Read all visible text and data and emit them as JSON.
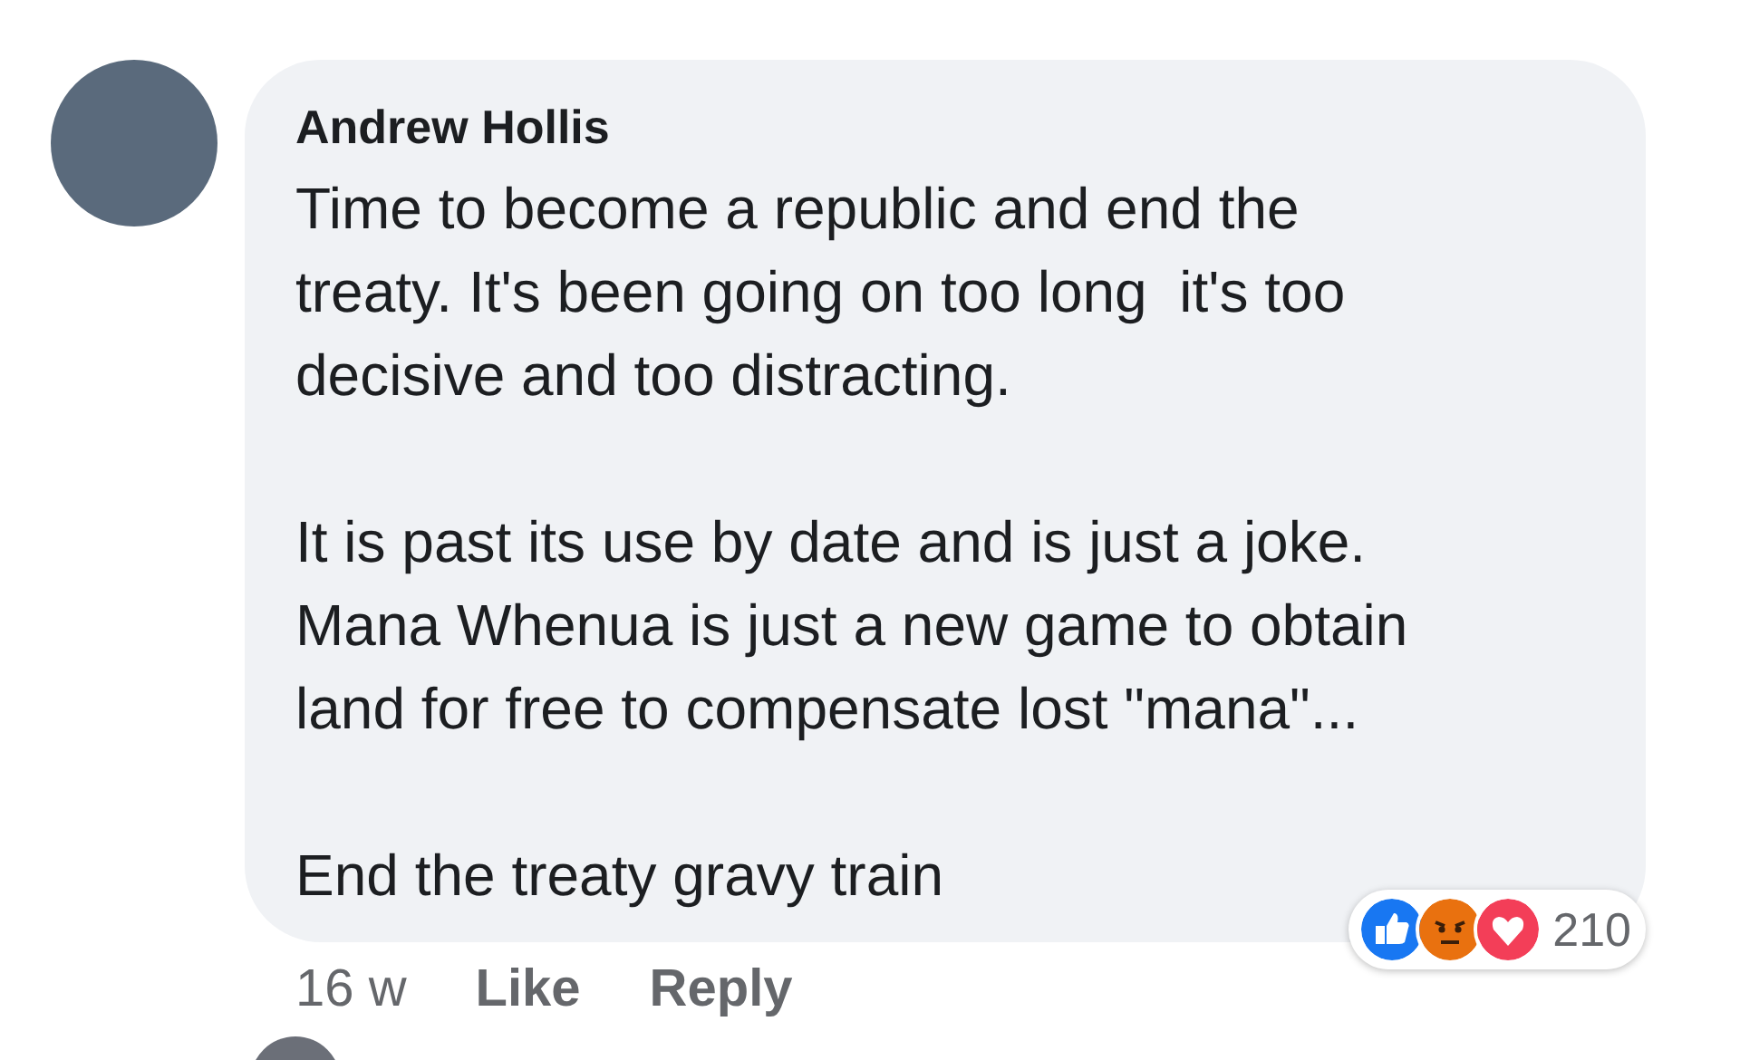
{
  "comment": {
    "author": "Andrew Hollis",
    "paragraphs": [
      "Time to become a republic and end the\ntreaty. It's been going on too long  it's too\ndecisive and too distracting.",
      "It is past its use by date and is just a joke.\nMana Whenua is just a new game to obtain\nland for free to compensate lost \"mana\"...",
      "End the treaty gravy train"
    ],
    "time": "16 w",
    "actions": [
      "Like",
      "Reply"
    ],
    "reactions": {
      "icons": [
        {
          "kind": "like"
        },
        {
          "kind": "angry"
        },
        {
          "kind": "love"
        }
      ],
      "count": "210"
    }
  }
}
